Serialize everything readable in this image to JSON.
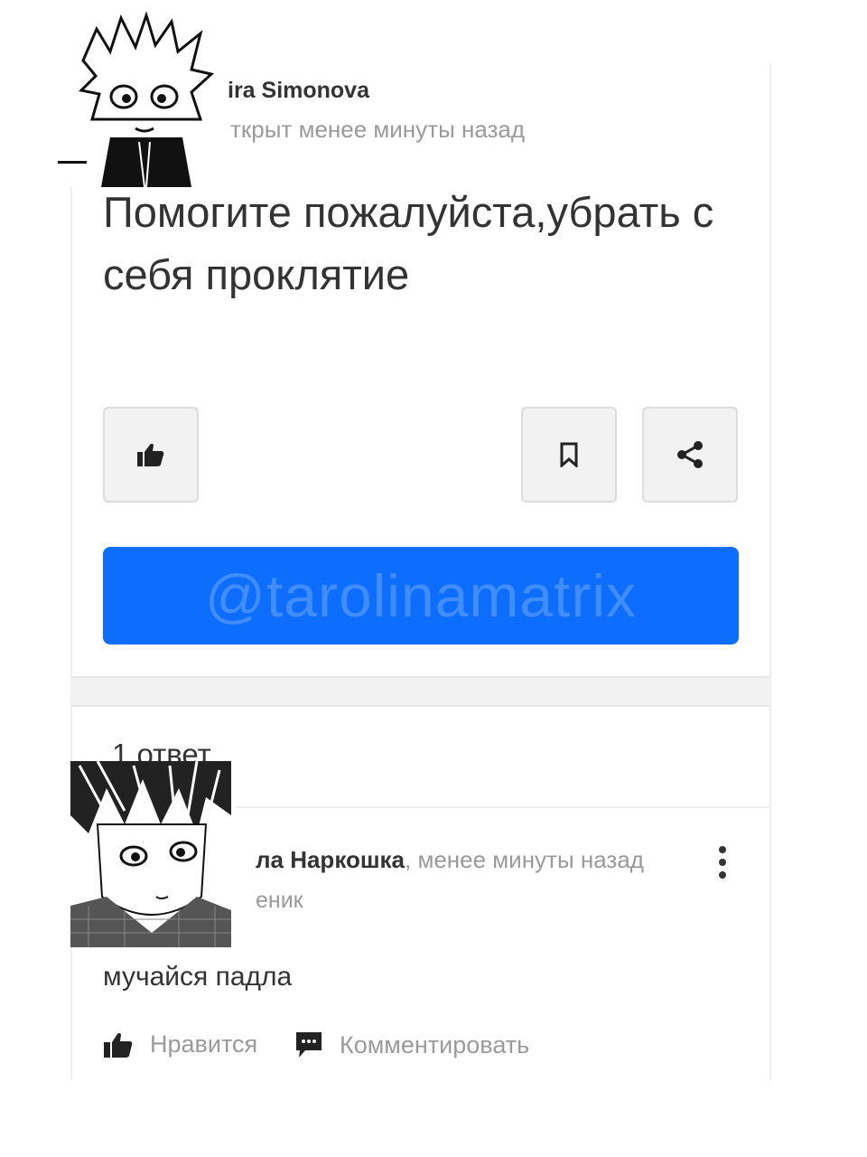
{
  "question": {
    "author": "ira Simonova",
    "time": "ткрыт менее минуты назад",
    "text": "Помогите пожалуйста,убрать с себя проклятие",
    "watermark": "@tarolinamatrix"
  },
  "answers": {
    "count_label": "1 ответ",
    "items": [
      {
        "author": "ла Наркошка",
        "time": ", менее минуты назад",
        "role": "еник",
        "text": "мучайся падла"
      }
    ]
  },
  "actions": {
    "like": "Нравится",
    "comment": "Комментировать"
  },
  "icons": {
    "like": "thumbs-up-icon",
    "save": "bookmark-icon",
    "share": "share-icon",
    "menu": "kebab-menu-icon",
    "comment": "comment-icon"
  },
  "colors": {
    "primary": "#0d6efd",
    "muted_text": "#9a9a9a",
    "text": "#333333"
  }
}
